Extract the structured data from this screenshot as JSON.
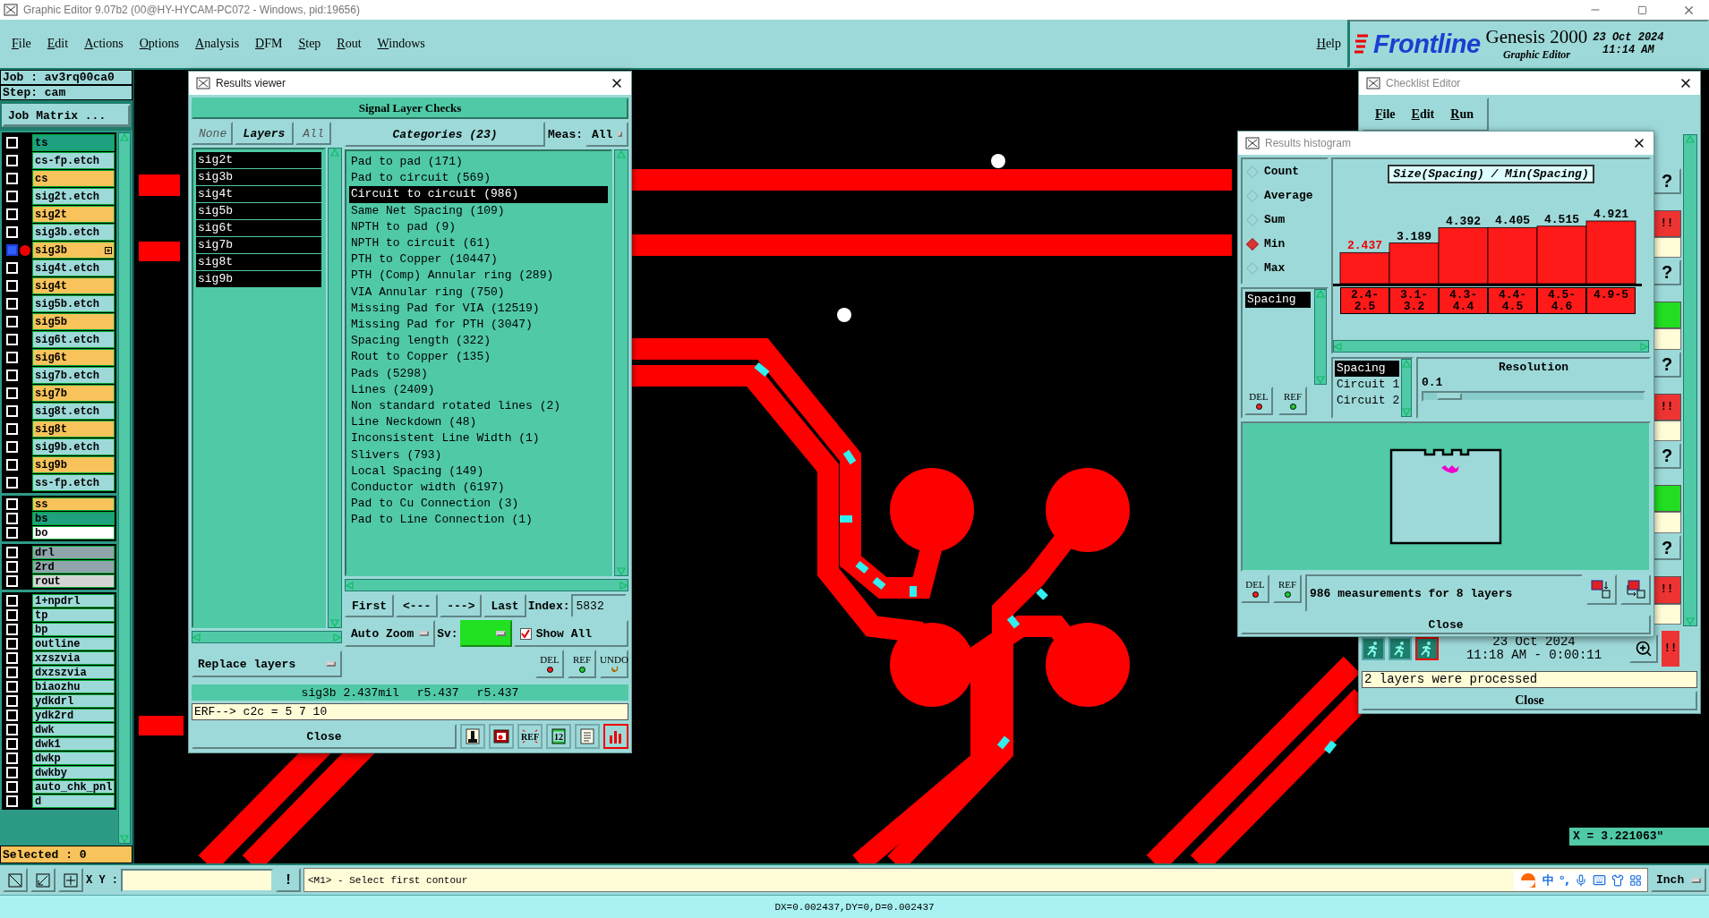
{
  "window": {
    "title": "Graphic Editor 9.07b2 (00@HY-HYCAM-PC072 - Windows, pid:19656)"
  },
  "menu": {
    "items": [
      "File",
      "Edit",
      "Actions",
      "Options",
      "Analysis",
      "DFM",
      "Step",
      "Rout",
      "Windows"
    ],
    "help": "Help"
  },
  "brand": {
    "logo": "Frontline",
    "product": "Genesis 2000",
    "subtitle": "Graphic Editor",
    "date": "23 Oct 2024",
    "time": "11:14 AM"
  },
  "job_panel": {
    "job": "Job : av3rq00ca0",
    "step": "Step: cam",
    "matrix_button": "Job Matrix ...",
    "selected_count": "Selected : 0",
    "layer_groups": [
      {
        "layers": [
          {
            "name": "ts",
            "color": "#1fa07f",
            "selected": false
          },
          {
            "name": "cs-fp.etch",
            "color": "#9ed9d9",
            "selected": false
          },
          {
            "name": "cs",
            "color": "#f7c35a",
            "selected": false
          },
          {
            "name": "sig2t.etch",
            "color": "#9ed9d9",
            "selected": false
          },
          {
            "name": "sig2t",
            "color": "#f7c35a",
            "selected": false
          },
          {
            "name": "sig3b.etch",
            "color": "#9ed9d9",
            "selected": false
          },
          {
            "name": "sig3b",
            "color": "#f7c35a",
            "selected": true
          },
          {
            "name": "sig4t.etch",
            "color": "#9ed9d9",
            "selected": false
          },
          {
            "name": "sig4t",
            "color": "#f7c35a",
            "selected": false
          },
          {
            "name": "sig5b.etch",
            "color": "#9ed9d9",
            "selected": false
          },
          {
            "name": "sig5b",
            "color": "#f7c35a",
            "selected": false
          },
          {
            "name": "sig6t.etch",
            "color": "#9ed9d9",
            "selected": false
          },
          {
            "name": "sig6t",
            "color": "#f7c35a",
            "selected": false
          },
          {
            "name": "sig7b.etch",
            "color": "#9ed9d9",
            "selected": false
          },
          {
            "name": "sig7b",
            "color": "#f7c35a",
            "selected": false
          },
          {
            "name": "sig8t.etch",
            "color": "#9ed9d9",
            "selected": false
          },
          {
            "name": "sig8t",
            "color": "#f7c35a",
            "selected": false
          },
          {
            "name": "sig9b.etch",
            "color": "#9ed9d9",
            "selected": false
          },
          {
            "name": "sig9b",
            "color": "#f7c35a",
            "selected": false
          },
          {
            "name": "ss-fp.etch",
            "color": "#9ed9d9",
            "selected": false
          }
        ]
      },
      {
        "layers": [
          {
            "name": "ss",
            "color": "#f7c35a",
            "selected": false
          },
          {
            "name": "bs",
            "color": "#1fa07f",
            "selected": false
          },
          {
            "name": "bo",
            "color": "#ffffff",
            "selected": false
          }
        ]
      },
      {
        "layers": [
          {
            "name": "drl",
            "color": "#8fa5ab",
            "selected": false
          },
          {
            "name": "2rd",
            "color": "#8fa5ab",
            "selected": false
          },
          {
            "name": "rout",
            "color": "#d4d4d4",
            "selected": false
          }
        ]
      },
      {
        "layers": [
          {
            "name": "1+npdrl",
            "color": "#9ed9d9",
            "selected": false
          },
          {
            "name": "tp",
            "color": "#9ed9d9",
            "selected": false
          },
          {
            "name": "bp",
            "color": "#9ed9d9",
            "selected": false
          },
          {
            "name": "outline",
            "color": "#9ed9d9",
            "selected": false
          },
          {
            "name": "xzszvia",
            "color": "#9ed9d9",
            "selected": false
          },
          {
            "name": "dxzszvia",
            "color": "#9ed9d9",
            "selected": false
          },
          {
            "name": "biaozhu",
            "color": "#9ed9d9",
            "selected": false
          },
          {
            "name": "ydkdrl",
            "color": "#9ed9d9",
            "selected": false
          },
          {
            "name": "ydk2rd",
            "color": "#9ed9d9",
            "selected": false
          },
          {
            "name": "dwk",
            "color": "#9ed9d9",
            "selected": false
          },
          {
            "name": "dwk1",
            "color": "#9ed9d9",
            "selected": false
          },
          {
            "name": "dwkp",
            "color": "#9ed9d9",
            "selected": false
          },
          {
            "name": "dwkby",
            "color": "#9ed9d9",
            "selected": false
          },
          {
            "name": "auto_chk_pnl",
            "color": "#9ed9d9",
            "selected": false
          },
          {
            "name": "d",
            "color": "#9ed9d9",
            "selected": false
          }
        ]
      }
    ]
  },
  "results_viewer": {
    "title": "Results viewer",
    "header": "Signal Layer Checks",
    "layer_buttons": [
      "None",
      "Layers",
      "All"
    ],
    "layers": [
      {
        "name": "sig2t",
        "selected": true
      },
      {
        "name": "sig3b",
        "selected": true
      },
      {
        "name": "sig4t",
        "selected": true
      },
      {
        "name": "sig5b",
        "selected": true
      },
      {
        "name": "sig6t",
        "selected": true
      },
      {
        "name": "sig7b",
        "selected": true
      },
      {
        "name": "sig8t",
        "selected": true
      },
      {
        "name": "sig9b",
        "selected": true
      }
    ],
    "replace_button": "Replace layers",
    "categories_button": "Categories (23)",
    "meas_label": "Meas:",
    "meas_value": "All",
    "categories": [
      {
        "label": "Pad to pad (171)",
        "selected": false
      },
      {
        "label": "Pad to circuit (569)",
        "selected": false
      },
      {
        "label": "Circuit to circuit (986)",
        "selected": true
      },
      {
        "label": "Same Net Spacing (109)",
        "selected": false
      },
      {
        "label": "NPTH to pad (9)",
        "selected": false
      },
      {
        "label": "NPTH to circuit (61)",
        "selected": false
      },
      {
        "label": "PTH to Copper (10447)",
        "selected": false
      },
      {
        "label": "PTH (Comp) Annular ring (289)",
        "selected": false
      },
      {
        "label": "VIA Annular ring (750)",
        "selected": false
      },
      {
        "label": "Missing Pad for VIA (12519)",
        "selected": false
      },
      {
        "label": "Missing Pad for PTH (3047)",
        "selected": false
      },
      {
        "label": "Spacing length (322)",
        "selected": false
      },
      {
        "label": "Rout to Copper (135)",
        "selected": false
      },
      {
        "label": "Pads (5298)",
        "selected": false
      },
      {
        "label": "Lines (2409)",
        "selected": false
      },
      {
        "label": "Non standard rotated lines (2)",
        "selected": false
      },
      {
        "label": "Line Neckdown (48)",
        "selected": false
      },
      {
        "label": "Inconsistent Line Width (1)",
        "selected": false
      },
      {
        "label": "Slivers (793)",
        "selected": false
      },
      {
        "label": "Local Spacing (149)",
        "selected": false
      },
      {
        "label": "Conductor width (6197)",
        "selected": false
      },
      {
        "label": "Pad to Cu Connection (3)",
        "selected": false
      },
      {
        "label": "Pad to Line Connection (1)",
        "selected": false
      }
    ],
    "nav_buttons": [
      "First",
      "<---",
      "--->",
      "Last"
    ],
    "index_label": "Index:",
    "index_value": "5832",
    "zoom_mode": "Auto Zoom",
    "sv_label": "Sv:",
    "show_all": {
      "label": "Show All",
      "checked": true
    },
    "actions": [
      {
        "label": "DEL",
        "kind": "delete"
      },
      {
        "label": "REF",
        "kind": "reference"
      },
      {
        "label": "UNDO",
        "kind": "undo"
      }
    ],
    "info": [
      "sig3b 2.437mil",
      "r5.437",
      "r5.437"
    ],
    "erf": "ERF--> c2c = 5 7 10",
    "close": "Close",
    "tools": [
      {
        "kind": "figure",
        "selected": false
      },
      {
        "kind": "record",
        "selected": false
      },
      {
        "kind": "crossed",
        "label": "REF",
        "selected": false
      },
      {
        "kind": "numbered",
        "label": "12",
        "selected": false
      },
      {
        "kind": "notes",
        "selected": false
      },
      {
        "kind": "chart",
        "selected": true
      }
    ]
  },
  "checklist_editor": {
    "title": "Checklist Editor",
    "menu": [
      "File",
      "Edit",
      "Run"
    ],
    "checks": [
      {
        "help": "?",
        "failed": true,
        "flag": "!!"
      },
      {
        "help": "?",
        "failed": false
      },
      {
        "help": "?",
        "failed": true,
        "flag": "!!"
      },
      {
        "help": "?",
        "failed": false
      },
      {
        "help": "?",
        "failed": true,
        "flag": "!!"
      }
    ],
    "run_date": "23 Oct 2024",
    "run_time": "11:18 AM - 0:00:11",
    "run_flag": "!!",
    "message": "2 layers were processed",
    "close": "Close"
  },
  "histogram": {
    "title": "Results histogram",
    "modes": [
      {
        "label": "Count",
        "selected": false
      },
      {
        "label": "Average",
        "selected": false
      },
      {
        "label": "Sum",
        "selected": false
      },
      {
        "label": "Min",
        "selected": true
      },
      {
        "label": "Max",
        "selected": false
      }
    ],
    "measures": [
      {
        "label": "Spacing",
        "selected": true
      }
    ],
    "list_actions": [
      {
        "label": "DEL",
        "kind": "delete"
      },
      {
        "label": "REF",
        "kind": "reference"
      }
    ],
    "bottom_actions": [
      {
        "label": "DEL",
        "kind": "delete"
      },
      {
        "label": "REF",
        "kind": "reference"
      }
    ],
    "chart_data": {
      "type": "bar",
      "title": "Size(Spacing) / Min(Spacing)",
      "categories": [
        "2.4-2.5",
        "3.1-3.2",
        "4.3-4.4",
        "4.4-4.5",
        "4.5-4.6",
        "4.9-5"
      ],
      "series": [
        {
          "color": "#ff1a1a",
          "values": [
            2.437,
            3.189,
            4.392,
            4.405,
            4.515,
            4.921
          ]
        }
      ],
      "data_labels": true
    },
    "fields": [
      {
        "label": "Spacing",
        "selected": true
      },
      {
        "label": "Circuit 1",
        "selected": false
      },
      {
        "label": "Circuit 2",
        "selected": false
      }
    ],
    "resolution": {
      "label": "Resolution",
      "value": "0.1",
      "level": 0.06
    },
    "summary": "986 measurements for 8 layers",
    "close": "Close"
  },
  "coordinate": "X = 3.221063\"",
  "toolbar": {
    "xy_label": "X Y :",
    "alert": "!",
    "message": "<M1> - Select first contour",
    "ime": [
      "中",
      "°,"
    ],
    "units": "Inch"
  },
  "status_bar": "DX=0.002437,DY=0,D=0.002437"
}
